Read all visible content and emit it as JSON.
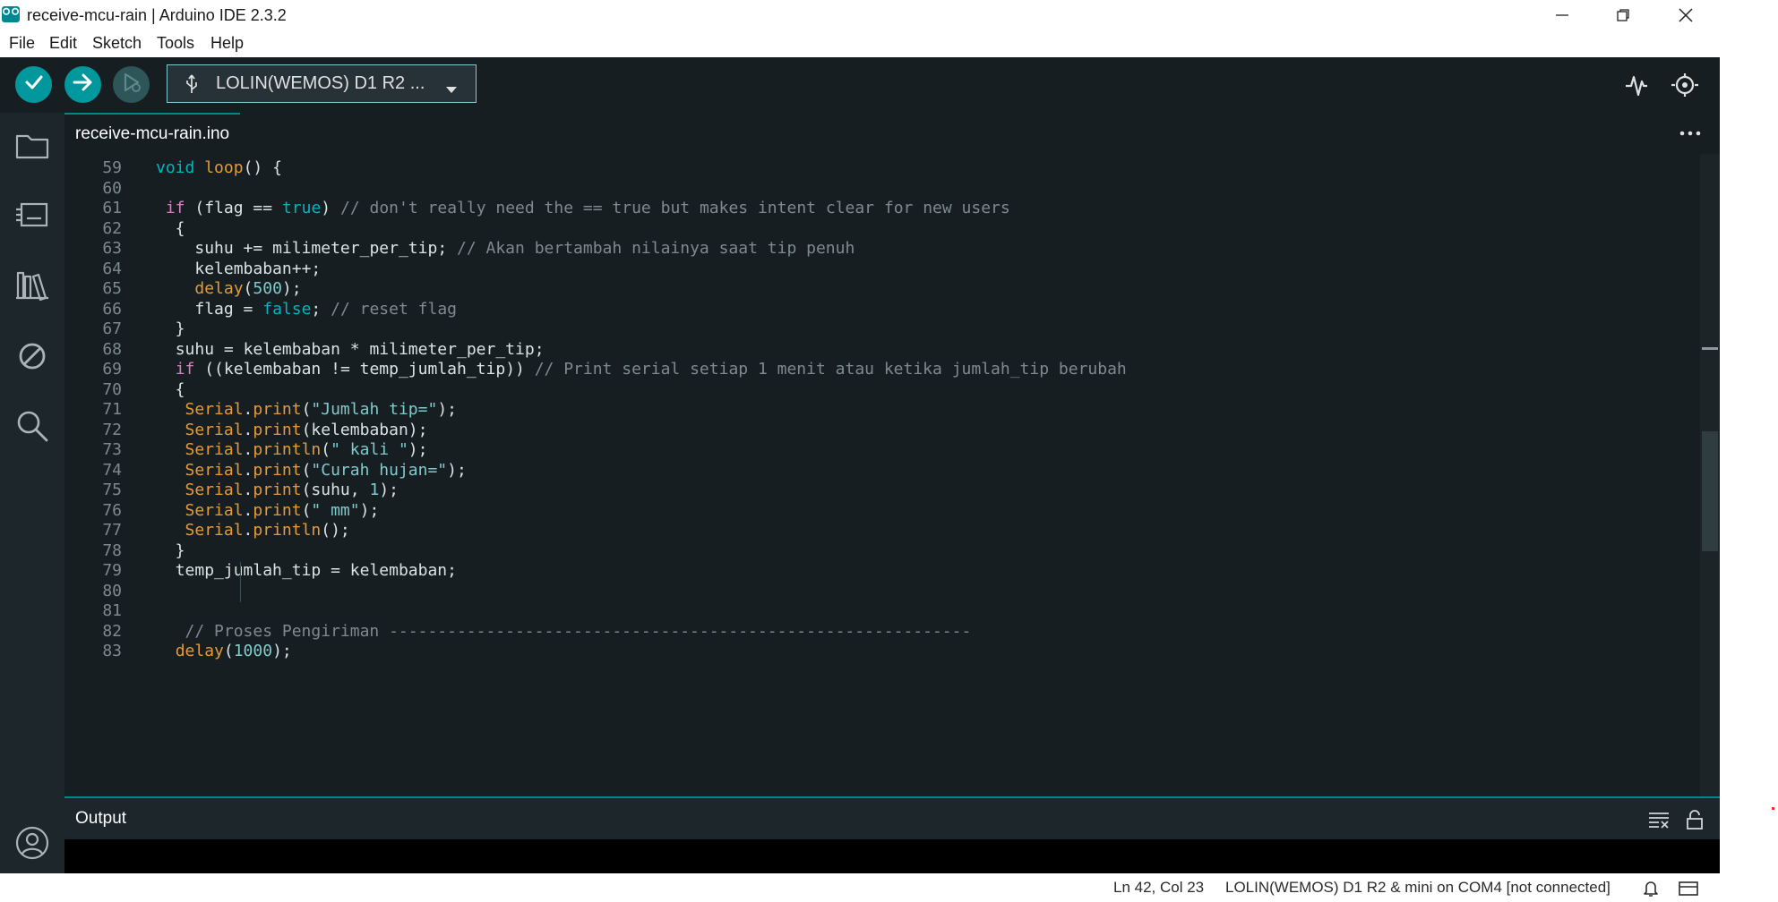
{
  "window": {
    "title": "receive-mcu-rain | Arduino IDE 2.3.2",
    "icon": "arduino-logo-icon",
    "controls": [
      "minimize-icon",
      "maximize-icon",
      "close-icon"
    ]
  },
  "menu": {
    "items": [
      "File",
      "Edit",
      "Sketch",
      "Tools",
      "Help"
    ]
  },
  "toolbar": {
    "buttons": [
      "verify-icon",
      "upload-icon",
      "debug-icon"
    ],
    "board_label": "LOLIN(WEMOS) D1 R2 ...",
    "right_icons": [
      "serial-plotter-icon",
      "serial-monitor-icon"
    ]
  },
  "sidebar": {
    "icons": [
      "sketchbook-folder-icon",
      "boards-manager-icon",
      "library-manager-icon",
      "debug-disabled-icon",
      "search-icon",
      "account-icon"
    ]
  },
  "tab": {
    "label": "receive-mcu-rain.ino"
  },
  "editor": {
    "lines": [
      {
        "n": "59",
        "code": "void loop() {"
      },
      {
        "n": "60",
        "code": ""
      },
      {
        "n": "61",
        "code": " if (flag == true) // don't really need the == true but makes intent clear for new users"
      },
      {
        "n": "62",
        "code": "  {"
      },
      {
        "n": "63",
        "code": "    suhu += milimeter_per_tip; // Akan bertambah nilainya saat tip penuh"
      },
      {
        "n": "64",
        "code": "    kelembaban++;"
      },
      {
        "n": "65",
        "code": "    delay(500);"
      },
      {
        "n": "66",
        "code": "    flag = false; // reset flag"
      },
      {
        "n": "67",
        "code": "  }"
      },
      {
        "n": "68",
        "code": "  suhu = kelembaban * milimeter_per_tip;"
      },
      {
        "n": "69",
        "code": "  if ((kelembaban != temp_jumlah_tip)) // Print serial setiap 1 menit atau ketika jumlah_tip berubah"
      },
      {
        "n": "70",
        "code": "  {"
      },
      {
        "n": "71",
        "code": "   Serial.print(\"Jumlah tip=\");"
      },
      {
        "n": "72",
        "code": "   Serial.print(kelembaban);"
      },
      {
        "n": "73",
        "code": "   Serial.println(\" kali \");"
      },
      {
        "n": "74",
        "code": "   Serial.print(\"Curah hujan=\");"
      },
      {
        "n": "75",
        "code": "   Serial.print(suhu, 1);"
      },
      {
        "n": "76",
        "code": "   Serial.print(\" mm\");"
      },
      {
        "n": "77",
        "code": "   Serial.println();"
      },
      {
        "n": "78",
        "code": "  }"
      },
      {
        "n": "79",
        "code": "  temp_jumlah_tip = kelembaban;"
      },
      {
        "n": "80",
        "code": ""
      },
      {
        "n": "81",
        "code": ""
      },
      {
        "n": "82",
        "code": "   // Proses Pengiriman ------------------------------------------------------------"
      },
      {
        "n": "83",
        "code": "  delay(1000);"
      }
    ]
  },
  "output": {
    "label": "Output",
    "icons": [
      "clear-output-icon",
      "lock-scroll-icon"
    ]
  },
  "status": {
    "position": "Ln 42, Col 23",
    "connection": "LOLIN(WEMOS) D1 R2 & mini on COM4 [not connected]",
    "icons": [
      "notification-bell-icon",
      "toggle-output-icon"
    ]
  },
  "colors": {
    "accent": "#00878f",
    "background": "#171e21",
    "keyword": "#d77fc0",
    "type": "#00b5c0",
    "function": "#e59a38",
    "string": "#7fcbcd",
    "comment": "#7d8b8f"
  }
}
